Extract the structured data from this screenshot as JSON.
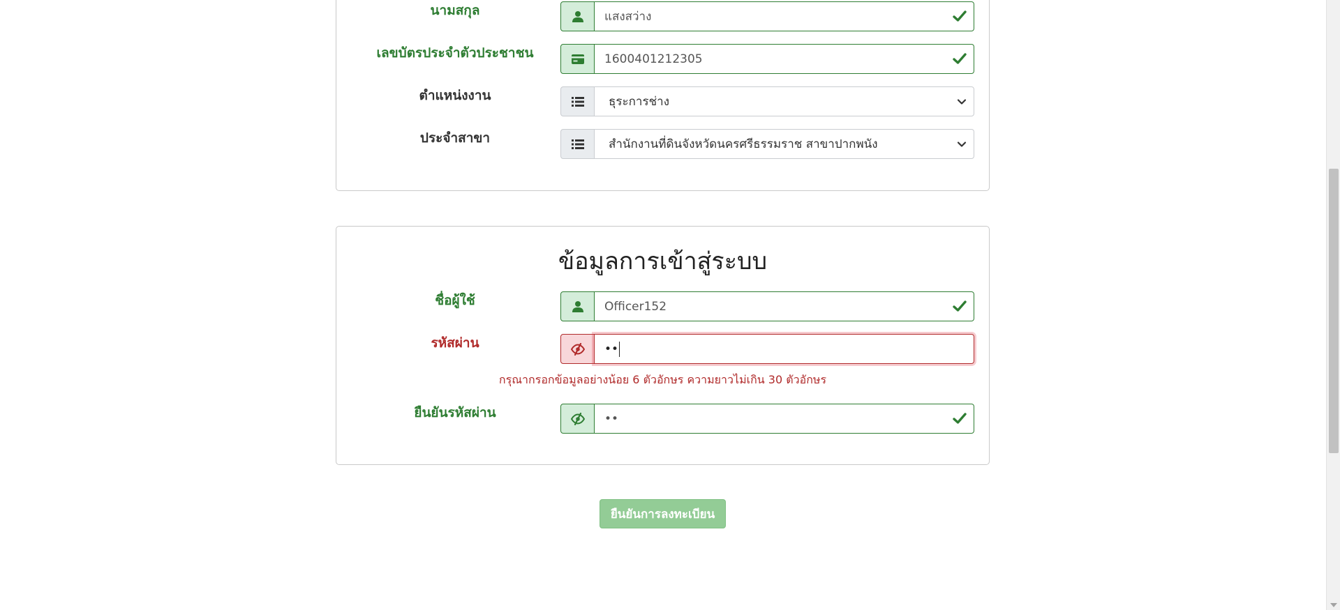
{
  "personal_info": {
    "lastname": {
      "label": "นามสกุล",
      "value": "แสงสว่าง",
      "icon": "user-icon",
      "state": "valid"
    },
    "id_card": {
      "label": "เลขบัตรประจำตัวประชาชน",
      "value": "1600401212305",
      "icon": "id-card-icon",
      "state": "valid"
    },
    "position": {
      "label": "ตำแหน่งงาน",
      "selected": "ธุระการช่าง",
      "icon": "list-icon"
    },
    "branch": {
      "label": "ประจำสาขา",
      "selected": "สำนักงานที่ดินจังหวัดนครศรีธรรมราช สาขาปากพนัง",
      "icon": "list-icon"
    }
  },
  "login_info": {
    "title": "ข้อมูลการเข้าสู่ระบบ",
    "username": {
      "label": "ชื่อผู้ใช้",
      "value": "Officer152",
      "icon": "user-icon",
      "state": "valid"
    },
    "password": {
      "label": "รหัสผ่าน",
      "value": "••",
      "icon": "eye-slash-icon",
      "state": "invalid",
      "error": "กรุณากรอกข้อมูลอย่างน้อย 6 ตัวอักษร ความยาวไม่เกิน 30 ตัวอักษร"
    },
    "confirm_password": {
      "label": "ยืนยันรหัสผ่าน",
      "value": "••",
      "icon": "eye-slash-icon",
      "state": "valid"
    }
  },
  "submit_label": "ยืนยันการลงทะเบียน",
  "colors": {
    "valid": "#2e7d32",
    "invalid": "#b02a2a",
    "button": "#93cc96"
  }
}
